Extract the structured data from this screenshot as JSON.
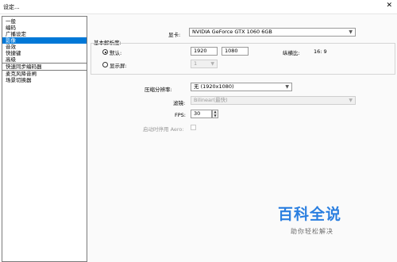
{
  "window": {
    "title": "设定...",
    "close_symbol": "✕"
  },
  "sidebar": {
    "items": [
      {
        "label": "一般",
        "selected": false
      },
      {
        "label": "编码",
        "selected": false
      },
      {
        "label": "广播设定",
        "selected": false
      },
      {
        "label": "影像",
        "selected": true
      },
      {
        "label": "音效",
        "selected": false
      },
      {
        "label": "快捷键",
        "selected": false
      },
      {
        "label": "高级",
        "selected": false
      },
      {
        "label": "快速同步编码器",
        "selected": false
      },
      {
        "label": "麦克风降音闸",
        "selected": false
      },
      {
        "label": "场景切换器",
        "selected": false
      }
    ]
  },
  "video": {
    "gpu_label": "显卡:",
    "gpu_value": "NVIDIA GeForce GTX 1060 6GB",
    "base_res_group": "基本解析度:",
    "default_label": "默认:",
    "width": "1920",
    "height": "1080",
    "aspect_label": "纵横比:",
    "aspect_value": "16: 9",
    "monitor_label": "显示屏:",
    "monitor_value": "1",
    "downscale_label": "压缩分辨率:",
    "downscale_value": "无 (1920x1080)",
    "filter_label": "滤镜:",
    "filter_value": "Bilinear(最快)",
    "fps_label": "FPS:",
    "fps_value": "30",
    "aero_label": "启动时停用 Aero:"
  },
  "watermark": {
    "title": "百科全说",
    "subtitle": "助你轻松解决"
  }
}
